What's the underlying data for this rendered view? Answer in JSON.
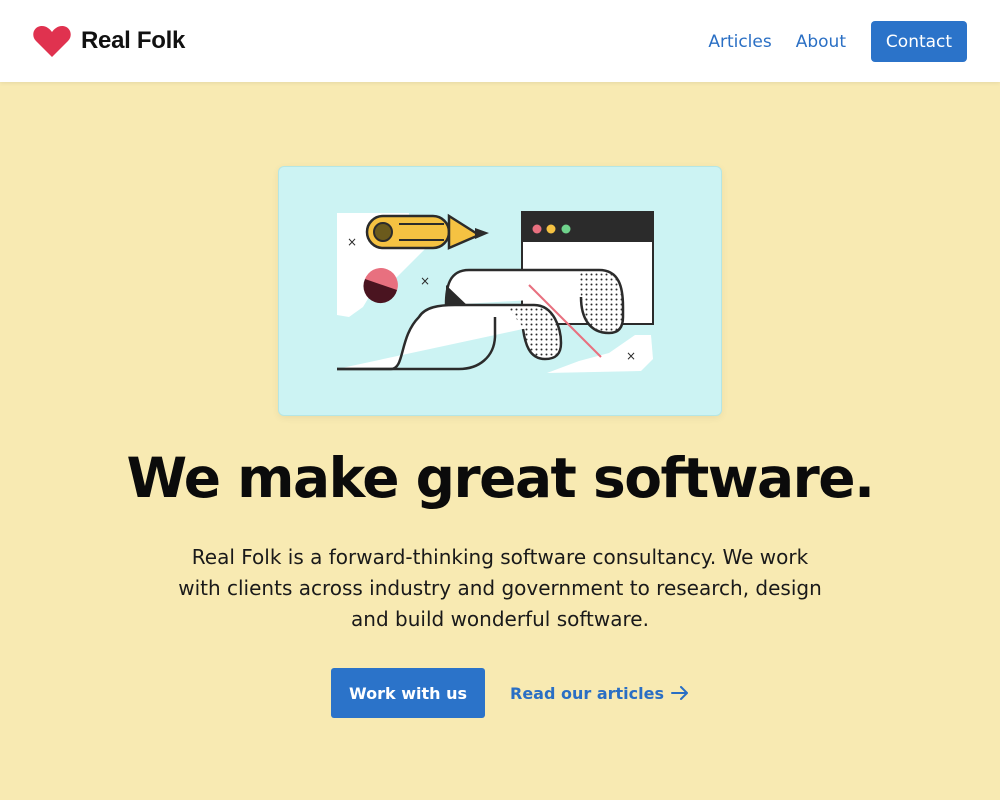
{
  "brand": {
    "name": "Real Folk",
    "logo_icon": "heart-icon",
    "accent": "#e0324f"
  },
  "nav": {
    "links": [
      "Articles",
      "About"
    ],
    "contact_label": "Contact"
  },
  "hero": {
    "illustration": "software-illustration",
    "title": "We make great software.",
    "description": "Real Folk is a forward-thinking software consultancy. We work with clients across industry and government to research, design and build wonderful software.",
    "primary_cta": "Work with us",
    "secondary_cta": "Read our articles",
    "secondary_icon": "arrow-right-icon"
  },
  "colors": {
    "link": "#2a6fc4",
    "button": "#2b73c9",
    "background": "#fdf9e6",
    "card": "#ccf3f3"
  }
}
